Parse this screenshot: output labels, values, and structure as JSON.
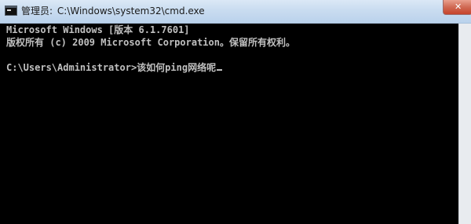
{
  "window": {
    "title_caption": "管理员",
    "title_path": "C:\\Windows\\system32\\cmd.exe",
    "close_glyph": "✕",
    "icon": "command-prompt-icon"
  },
  "console": {
    "lines": {
      "banner_1": "Microsoft Windows [版本 6.1.7601]",
      "banner_2": "版权所有 (c) 2009 Microsoft Corporation。保留所有权利。",
      "blank_1": "",
      "prompt_path": "C:\\Users\\Administrator>",
      "input_text": "该如何ping网络呢"
    }
  },
  "colors": {
    "console_background": "#000000",
    "console_text": "#c0c0c0",
    "title_bar": "#cfe0f1",
    "close_button": "#c6432b"
  }
}
